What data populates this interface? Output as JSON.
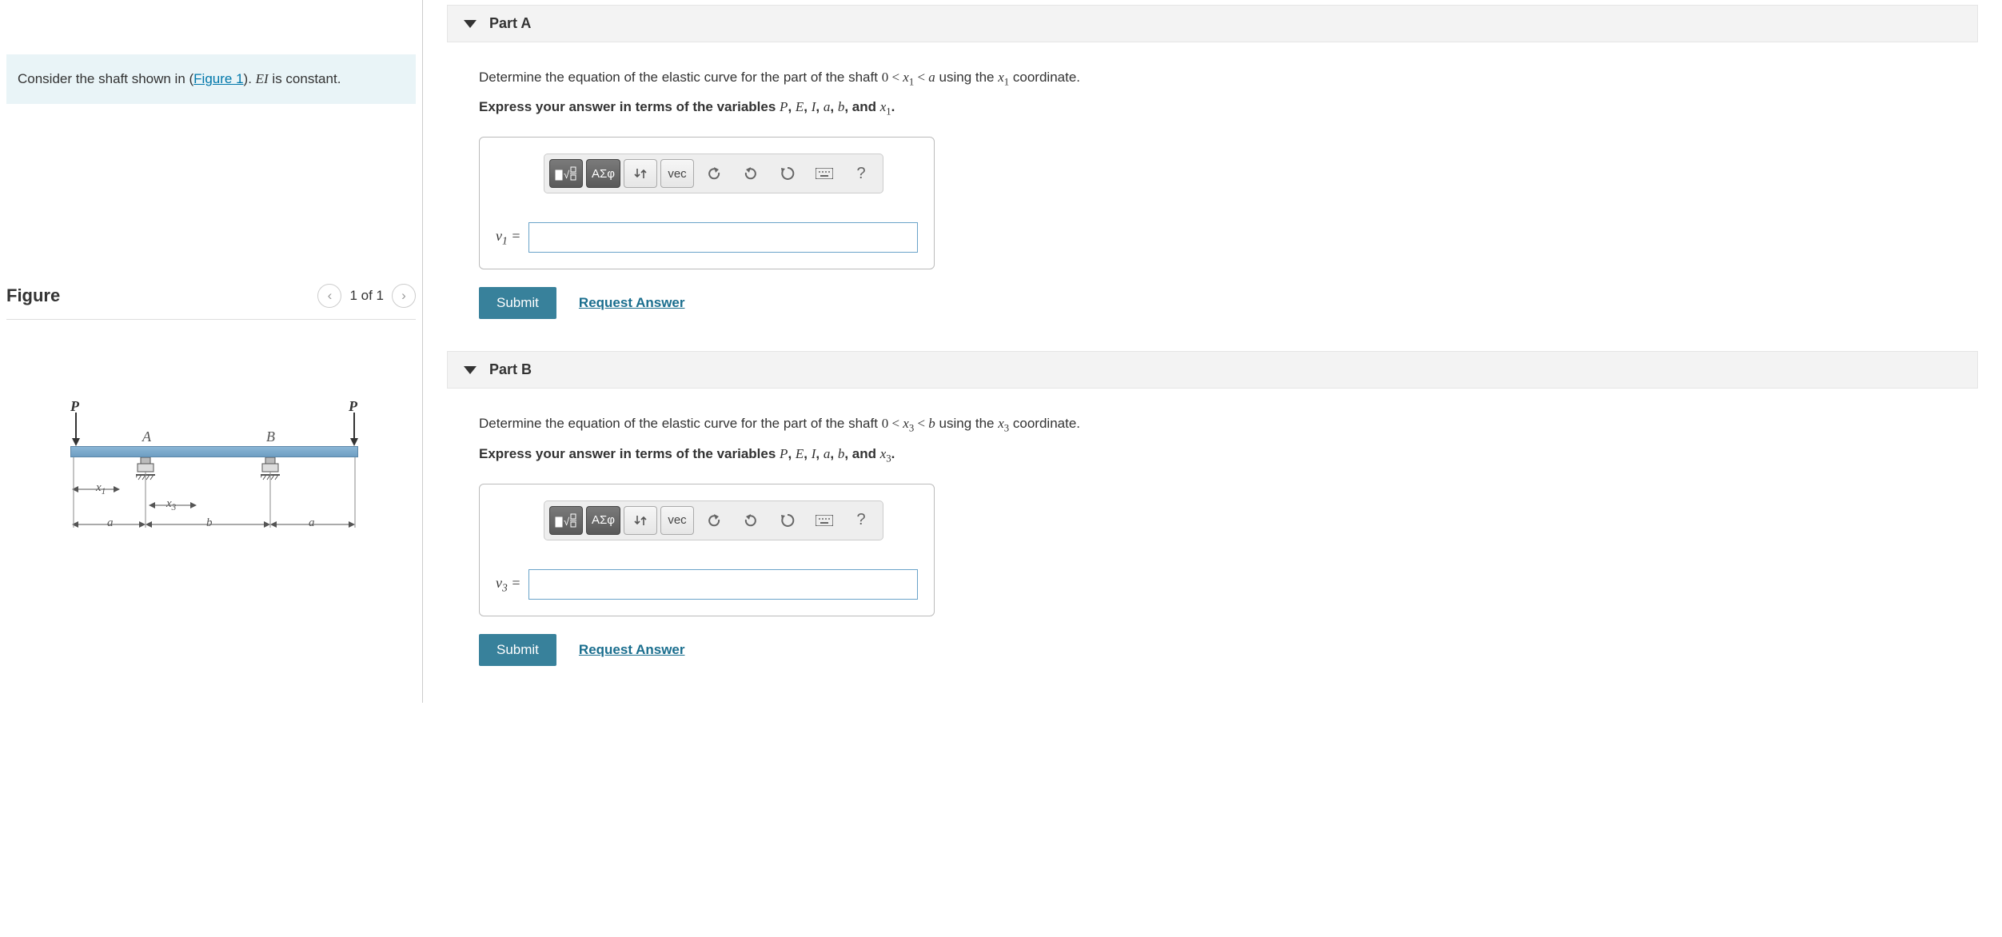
{
  "prompt": {
    "prefix": "Consider the shaft shown in (",
    "figure_link": "Figure 1",
    "suffix_before_ei": "). ",
    "ei_text": "EI",
    "suffix": " is constant."
  },
  "figure": {
    "title": "Figure",
    "pager_text": "1 of 1",
    "labels": {
      "P_left": "P",
      "P_right": "P",
      "A": "A",
      "B": "B",
      "x1": "x",
      "x1_sub": "1",
      "x3": "x",
      "x3_sub": "3",
      "a_left": "a",
      "b_mid": "b",
      "a_right": "a"
    }
  },
  "parts": [
    {
      "header": "Part A",
      "question_pre": "Determine the equation of the elastic curve for the part of the shaft ",
      "range_math": "0 < x₁ < a",
      "question_mid": " using the ",
      "coord": "x₁",
      "question_post": " coordinate.",
      "instruction_pre": "Express your answer in terms of the variables ",
      "vars": "P, E, I, a, b,",
      "instruction_post": " and ",
      "last_var": "x₁",
      "period": ".",
      "label": "v₁ =",
      "toolbar": {
        "templates": "▮√☐",
        "greek": "ΑΣφ",
        "scripts": "↓↑",
        "vec": "vec",
        "undo": "↶",
        "redo": "↷",
        "reset": "↻",
        "keyboard": "⌨",
        "help": "?"
      },
      "submit": "Submit",
      "request": "Request Answer"
    },
    {
      "header": "Part B",
      "question_pre": "Determine the equation of the elastic curve for the part of the shaft ",
      "range_math": "0 < x₃ < b",
      "question_mid": " using the ",
      "coord": "x₃",
      "question_post": " coordinate.",
      "instruction_pre": "Express your answer in terms of the variables ",
      "vars": "P, E, I, a, b,",
      "instruction_post": " and ",
      "last_var": "x₃",
      "period": ".",
      "label": "v₃ =",
      "toolbar": {
        "templates": "▮√☐",
        "greek": "ΑΣφ",
        "scripts": "↓↑",
        "vec": "vec",
        "undo": "↶",
        "redo": "↷",
        "reset": "↻",
        "keyboard": "⌨",
        "help": "?"
      },
      "submit": "Submit",
      "request": "Request Answer"
    }
  ]
}
